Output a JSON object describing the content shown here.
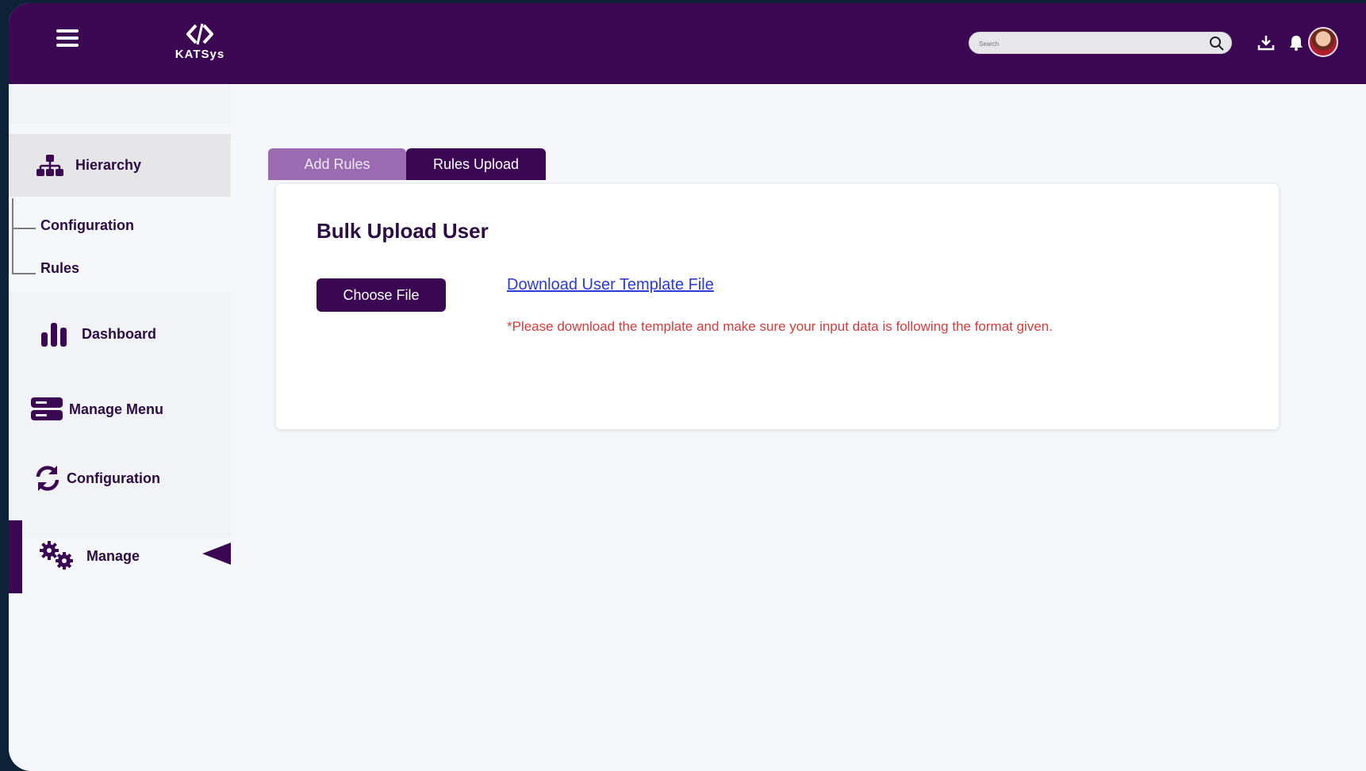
{
  "app": {
    "brand_name": "KATSys",
    "search_placeholder": "Search",
    "colors": {
      "primary": "#3b0752",
      "tab_inactive": "#9a6bb0",
      "link": "#2c3ad6",
      "warning_text": "#d43b3b"
    }
  },
  "header": {
    "icons": [
      "menu-icon",
      "download-icon",
      "bell-icon",
      "user-avatar"
    ]
  },
  "sidebar": {
    "hierarchy": {
      "label": "Hierarchy",
      "icon": "hierarchy-icon",
      "children": [
        "Configuration",
        "Rules"
      ]
    },
    "items": [
      {
        "label": "Dashboard",
        "icon": "bar-chart-icon"
      },
      {
        "label": "Manage Menu",
        "icon": "server-icon"
      },
      {
        "label": "Configuration",
        "icon": "sync-icon"
      },
      {
        "label": "Manage",
        "icon": "gears-icon",
        "active": true
      }
    ]
  },
  "tabs": [
    {
      "label": "Add Rules",
      "active": false
    },
    {
      "label": "Rules Upload",
      "active": true
    }
  ],
  "card": {
    "title": "Bulk Upload User",
    "choose_file_label": "Choose File",
    "download_link_label": "Download User Template File",
    "note": "*Please download the template and make sure your input data is following the format given."
  }
}
